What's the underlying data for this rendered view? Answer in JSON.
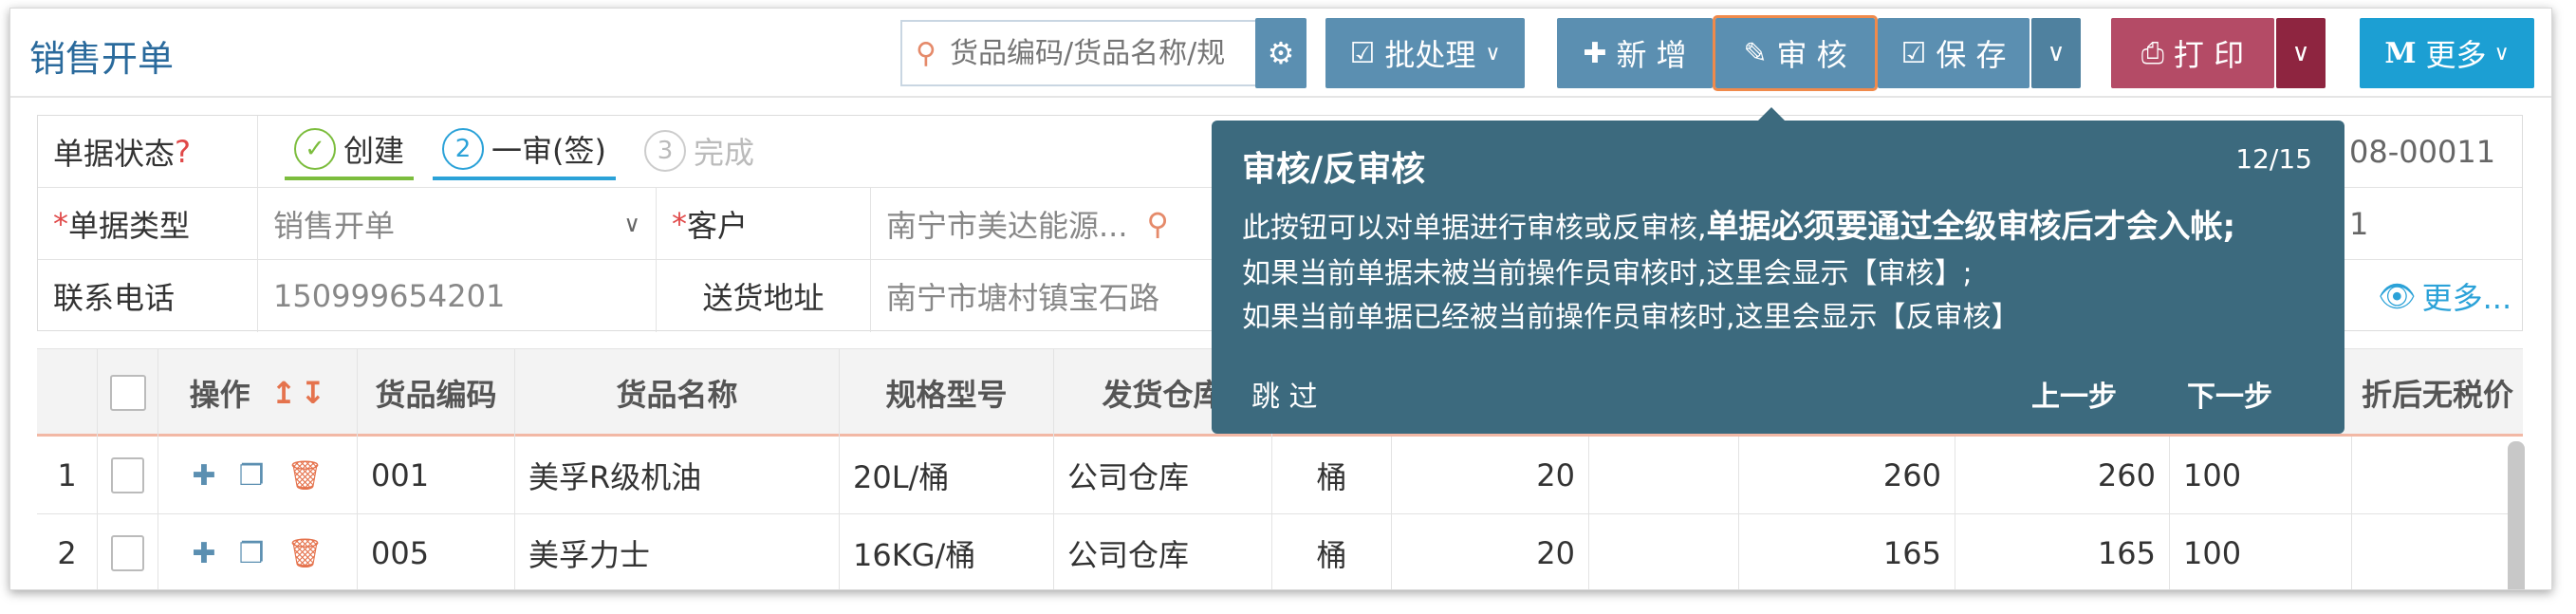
{
  "page": {
    "title": "销售开单"
  },
  "toolbar": {
    "search_placeholder": "货品编码/货品名称/规",
    "batch_label": "批处理",
    "add_label": "新 增",
    "audit_label": "审 核",
    "save_label": "保 存",
    "print_label": "打 印",
    "more_label": "更多"
  },
  "form": {
    "status_label": "单据状态",
    "status_help": "?",
    "steps": [
      {
        "num": "✓",
        "label": "创建"
      },
      {
        "num": "2",
        "label": "一审(签)"
      },
      {
        "num": "3",
        "label": "完成"
      }
    ],
    "order_no_partial": "08-00011",
    "type_label": "单据类型",
    "type_value": "销售开单",
    "customer_label": "客户",
    "customer_value": "南宁市美达能源...",
    "right_partial_1": "1",
    "phone_label": "联系电话",
    "phone_value": "150999654201",
    "address_label": "送货地址",
    "address_value": "南宁市塘村镇宝石路",
    "more_link": "更多..."
  },
  "grid": {
    "headers": {
      "op": "操作",
      "code": "货品编码",
      "name": "货品名称",
      "spec": "规格型号",
      "warehouse": "发货仓库",
      "after_tax_partial": "折后无税价"
    },
    "rows": [
      {
        "no": "1",
        "code": "001",
        "name": "美孚R级机油",
        "spec": "20L/桶",
        "warehouse": "公司仓库",
        "unit": "桶",
        "qty": "20",
        "price": "260",
        "price2": "260",
        "rate": "100"
      },
      {
        "no": "2",
        "code": "005",
        "name": "美孚力士",
        "spec": "16KG/桶",
        "warehouse": "公司仓库",
        "unit": "桶",
        "qty": "20",
        "price": "165",
        "price2": "165",
        "rate": "100"
      }
    ]
  },
  "tooltip": {
    "title": "审核/反审核",
    "counter": "12/15",
    "line1_plain": "此按钮可以对单据进行审核或反审核,",
    "line1_bold": "单据必须要通过全级审核后才会入帐;",
    "line2": "如果当前单据未被当前操作员审核时,这里会显示【审核】;",
    "line3": "如果当前单据已经被当前操作员审核时,这里会显示【反审核】",
    "skip": "跳 过",
    "prev": "上一步",
    "next": "下一步"
  },
  "colors": {
    "primary": "#5b8fb1",
    "print": "#b44b66",
    "more": "#1c9fd3",
    "tooltip": "#3c6a7e",
    "highlight": "#f08a4b"
  }
}
